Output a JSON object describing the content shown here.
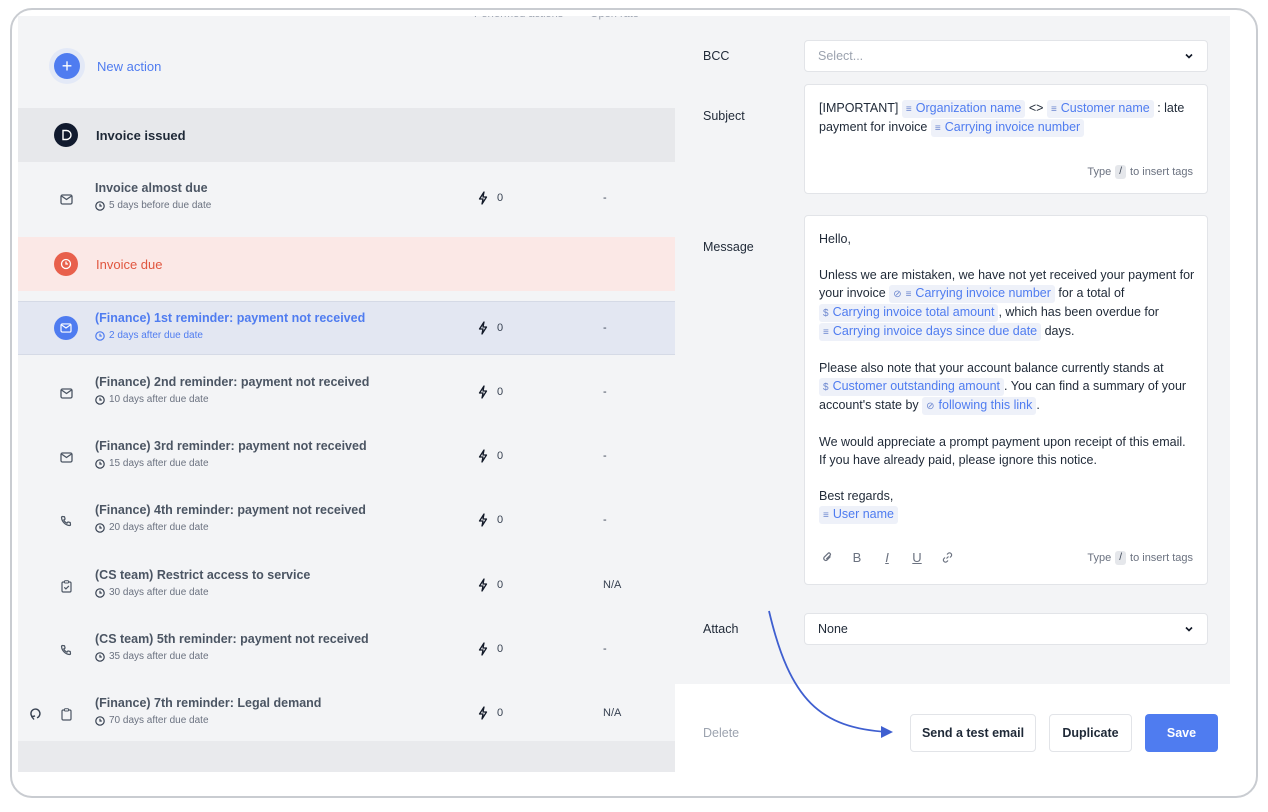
{
  "left_panel": {
    "column_headers": {
      "performed_actions": "Performed actions",
      "open_rate": "Open rate"
    },
    "new_action_label": "New action",
    "sections": {
      "invoice_issued": "Invoice issued",
      "invoice_due": "Invoice due"
    },
    "actions": [
      {
        "title": "Invoice almost due",
        "timing": "5 days before due date",
        "count": "0",
        "rate": "-",
        "icon": "mail-icon"
      },
      {
        "title": "(Finance) 1st reminder: payment not received",
        "timing": "2 days after due date",
        "count": "0",
        "rate": "-",
        "icon": "mail-icon",
        "selected": true
      },
      {
        "title": "(Finance) 2nd reminder: payment not received",
        "timing": "10 days after due date",
        "count": "0",
        "rate": "-",
        "icon": "mail-icon"
      },
      {
        "title": "(Finance) 3rd reminder: payment not received",
        "timing": "15 days after due date",
        "count": "0",
        "rate": "-",
        "icon": "mail-icon"
      },
      {
        "title": "(Finance) 4th reminder: payment not received",
        "timing": "20 days after due date",
        "count": "0",
        "rate": "-",
        "icon": "phone-icon"
      },
      {
        "title": "(CS team) Restrict access to service",
        "timing": "30 days after due date",
        "count": "0",
        "rate": "N/A",
        "icon": "clipboard-check-icon"
      },
      {
        "title": "(CS team) 5th reminder: payment not received",
        "timing": "35 days after due date",
        "count": "0",
        "rate": "-",
        "icon": "phone-icon"
      },
      {
        "title": "(Finance) 7th reminder: Legal demand",
        "timing": "70 days after due date",
        "count": "0",
        "rate": "N/A",
        "icon": "clipboard-icon"
      }
    ]
  },
  "form": {
    "bcc_label": "BCC",
    "bcc_placeholder": "Select...",
    "subject_label": "Subject",
    "subject": {
      "prefix": "[IMPORTANT]",
      "tag1": "Organization name",
      "sep": "<>",
      "tag2": "Customer name",
      "after": ": late",
      "line2_text": "payment for invoice",
      "tag3": "Carrying invoice number"
    },
    "hint_prefix": "Type",
    "hint_key": "/",
    "hint_suffix": "to insert tags",
    "message_label": "Message",
    "message": {
      "greeting": "Hello,",
      "p1_l1": "Unless we are mistaken, we have not yet received your payment for",
      "p1_l2_text": "your invoice",
      "p1_l2_tag": "Carrying invoice number",
      "p1_l2_after": "for a total of",
      "p1_l3_tag": "Carrying invoice total amount",
      "p1_l3_after": ", which has been overdue for",
      "p1_l4_tag": "Carrying invoice days since due date",
      "p1_l4_after": "days.",
      "p2_l1": "Please also note that your account balance currently stands at",
      "p2_l2_tag": "Customer outstanding amount",
      "p2_l2_after": ". You can find a summary of your",
      "p2_l3_text": "account's state by",
      "p2_l3_link": "following this link",
      "p2_l3_after": ".",
      "p3_l1": "We would appreciate a prompt payment upon receipt of this email.",
      "p3_l2": "If you have already paid, please ignore this notice.",
      "closing": "Best regards,",
      "signature_tag": "User name"
    },
    "attach_label": "Attach",
    "attach_value": "None"
  },
  "footer": {
    "delete": "Delete",
    "send_test": "Send a test email",
    "duplicate": "Duplicate",
    "save": "Save"
  },
  "colors": {
    "accent": "#4f7cf0",
    "due_red": "#e8604c",
    "dark": "#111a2e"
  }
}
